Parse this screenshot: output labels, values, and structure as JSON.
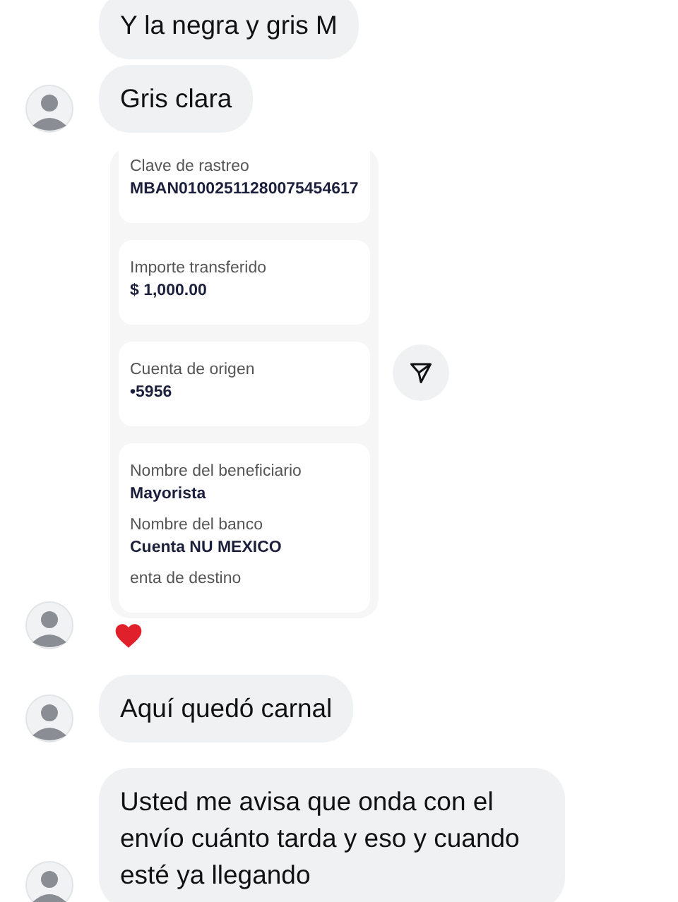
{
  "messages": [
    {
      "kind": "text",
      "text": "Y la negra y gris M",
      "avatar": false
    },
    {
      "kind": "text",
      "text": "Gris clara",
      "avatar": true
    },
    {
      "kind": "image",
      "avatar": true,
      "heart_reaction": true,
      "share_button": true,
      "cards": [
        {
          "fields": [
            {
              "label": "Clave de rastreo",
              "value": "MBAN01002511280075454617"
            }
          ]
        },
        {
          "fields": [
            {
              "label": "Importe transferido",
              "value": "$ 1,000.00"
            }
          ]
        },
        {
          "fields": [
            {
              "label": "Cuenta de origen",
              "value": "•5956"
            }
          ]
        },
        {
          "fields": [
            {
              "label": "Nombre del beneficiario",
              "value": "Mayorista"
            },
            {
              "label": "Nombre del banco",
              "value": "Cuenta NU MEXICO"
            },
            {
              "label": "enta de destino"
            }
          ]
        }
      ]
    },
    {
      "kind": "text",
      "text": "Aquí quedó carnal",
      "avatar": true
    },
    {
      "kind": "text",
      "text": "Usted me avisa que onda con el envío cuánto tarda y eso y cuando esté ya llegando",
      "avatar": true
    }
  ]
}
